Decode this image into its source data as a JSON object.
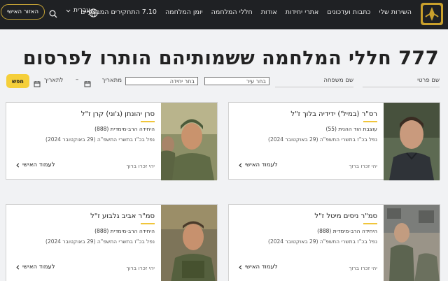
{
  "nav": {
    "items": [
      "השירות שלי",
      "כתבות ועדכונים",
      "אתרי יחידות",
      "אודות",
      "חללי המלחמה",
      "יומן המלחמה",
      "7.10 התחקירים המבצעיים"
    ],
    "language": "עברית",
    "personal_area": "האזור האישי"
  },
  "page": {
    "title": "777 חללי המלחמה ששמותיהם הותרו לפרסום"
  },
  "filters": {
    "first_name": "שם פרטי",
    "last_name": "שם משפחה",
    "city": "בחר עיר",
    "unit": "בחר יחידה",
    "from_date": "מתאריך",
    "dash": "–",
    "to_date": "לתאריך",
    "search": "חפש"
  },
  "cards": [
    {
      "name": "רס\"ר (במיל') ידידיה בלוך ז\"ל",
      "unit": "עוצבת הוד ההנית (55)",
      "date": "נפל בכ\"ז בתשרי התשפ\"ה (29 באוקטובר 2024)",
      "memory": "יהי זכרו ברוך",
      "link": "לעמוד האישי"
    },
    {
      "name": "סרן יהונתן (ג'וני) קרן ז\"ל",
      "unit": "היחידה הרב-מימדית (888)",
      "date": "נפל בכ\"ז בתשרי התשפ\"ה (29 באוקטובר 2024)",
      "memory": "יהי זכרו ברוך",
      "link": "לעמוד האישי"
    },
    {
      "name": "סמ\"ר ניסים מיטל ז\"ל",
      "unit": "היחידה הרב-מימדית (888)",
      "date": "נפל בכ\"ז בתשרי התשפ\"ה (29 באוקטובר 2024)",
      "memory": "יהי זכרו ברוך",
      "link": "לעמוד האישי"
    },
    {
      "name": "סמ\"ר אביב גלבוע ז\"ל",
      "unit": "היחידה הרב-מימדית (888)",
      "date": "נפל בכ\"ז בתשרי התשפ\"ה (29 באוקטובר 2024)",
      "memory": "יהי זכרו ברוך",
      "link": "לעמוד האישי"
    }
  ],
  "colors": {
    "nav_bg": "#1f2124",
    "accent_yellow": "#f5cf3a",
    "page_bg": "#f1f2f4"
  },
  "icons": [
    "idf-logo-icon",
    "globe-icon",
    "chevron-down-icon",
    "search-icon",
    "calendar-icon",
    "chevron-left-icon"
  ]
}
